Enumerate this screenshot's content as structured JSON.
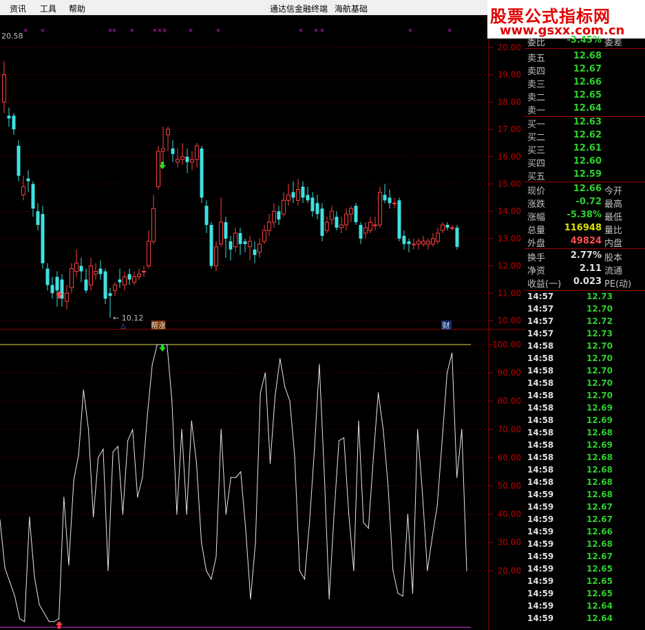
{
  "menu": {
    "items": [
      "资讯",
      "工具",
      "帮助"
    ],
    "title": "通达信金融终端",
    "module": "海航基础"
  },
  "watermark": {
    "line1": "股票公式指标网",
    "line2": "www.gsxx.com.cn",
    "diamond": "◇"
  },
  "price_panel": {
    "top_value": "20.58",
    "low_marker": "10.12",
    "badge_bangzhang": "帮涨",
    "badge_cai": "财",
    "badge_triangle": "△"
  },
  "chart_data": [
    {
      "type": "candlestick",
      "title": "",
      "y_ticks": [
        "20.00",
        "19.00",
        "18.00",
        "17.00",
        "16.00",
        "15.00",
        "14.00",
        "13.00",
        "12.00",
        "11.00",
        "10.00"
      ],
      "ylim": [
        9.6,
        21.2
      ],
      "candles": [
        {
          "o": 18.0,
          "c": 19.0,
          "h": 19.5,
          "l": 17.6
        },
        {
          "o": 17.5,
          "c": 17.4,
          "h": 17.8,
          "l": 17.1
        },
        {
          "o": 17.5,
          "c": 17.0,
          "h": 17.6,
          "l": 16.8
        },
        {
          "o": 16.4,
          "c": 15.3,
          "h": 16.6,
          "l": 15.1
        },
        {
          "o": 14.6,
          "c": 14.9,
          "h": 15.3,
          "l": 14.4
        },
        {
          "o": 15.2,
          "c": 15.1,
          "h": 15.5,
          "l": 14.7
        },
        {
          "o": 15.0,
          "c": 14.1,
          "h": 15.1,
          "l": 13.8
        },
        {
          "o": 14.0,
          "c": 13.5,
          "h": 14.3,
          "l": 13.3
        },
        {
          "o": 13.9,
          "c": 12.1,
          "h": 14.2,
          "l": 11.9
        },
        {
          "o": 11.9,
          "c": 11.3,
          "h": 12.1,
          "l": 11.1
        },
        {
          "o": 11.3,
          "c": 11.0,
          "h": 11.6,
          "l": 10.8
        },
        {
          "o": 11.6,
          "c": 11.1,
          "h": 11.8,
          "l": 10.5
        },
        {
          "o": 11.5,
          "c": 10.8,
          "h": 11.7,
          "l": 10.5
        },
        {
          "o": 10.7,
          "c": 11.0,
          "h": 11.3,
          "l": 10.4
        },
        {
          "o": 11.2,
          "c": 11.9,
          "h": 12.1,
          "l": 11.0
        },
        {
          "o": 11.8,
          "c": 12.1,
          "h": 12.6,
          "l": 11.6
        },
        {
          "o": 12.0,
          "c": 11.8,
          "h": 12.3,
          "l": 11.4
        },
        {
          "o": 11.5,
          "c": 11.1,
          "h": 11.9,
          "l": 11.0
        },
        {
          "o": 11.3,
          "c": 12.0,
          "h": 12.3,
          "l": 11.1
        },
        {
          "o": 11.7,
          "c": 11.8,
          "h": 12.1,
          "l": 11.5
        },
        {
          "o": 11.9,
          "c": 11.7,
          "h": 12.2,
          "l": 11.5
        },
        {
          "o": 11.8,
          "c": 10.8,
          "h": 11.9,
          "l": 10.6
        },
        {
          "o": 11.0,
          "c": 10.9,
          "h": 11.2,
          "l": 10.1
        },
        {
          "o": 11.1,
          "c": 11.3,
          "h": 11.4,
          "l": 10.9
        },
        {
          "o": 11.5,
          "c": 11.4,
          "h": 11.9,
          "l": 11.2
        },
        {
          "o": 11.3,
          "c": 11.6,
          "h": 11.8,
          "l": 11.1
        },
        {
          "o": 11.7,
          "c": 11.5,
          "h": 11.9,
          "l": 11.3
        },
        {
          "o": 11.4,
          "c": 11.6,
          "h": 11.8,
          "l": 11.3
        },
        {
          "o": 11.6,
          "c": 11.7,
          "h": 11.9,
          "l": 11.5
        },
        {
          "o": 11.8,
          "c": 11.8,
          "h": 12.0,
          "l": 11.6
        },
        {
          "o": 12.0,
          "c": 12.9,
          "h": 13.3,
          "l": 11.9
        },
        {
          "o": 12.9,
          "c": 14.1,
          "h": 14.6,
          "l": 12.8
        },
        {
          "o": 14.9,
          "c": 16.2,
          "h": 16.4,
          "l": 14.8
        },
        {
          "o": 16.2,
          "c": 16.3,
          "h": 17.1,
          "l": 15.8
        },
        {
          "o": 16.8,
          "c": 17.0,
          "h": 17.1,
          "l": 16.2
        },
        {
          "o": 16.3,
          "c": 16.1,
          "h": 16.6,
          "l": 15.8
        },
        {
          "o": 15.8,
          "c": 15.9,
          "h": 16.3,
          "l": 15.6
        },
        {
          "o": 15.9,
          "c": 16.0,
          "h": 16.5,
          "l": 15.7
        },
        {
          "o": 16.0,
          "c": 15.8,
          "h": 16.3,
          "l": 15.4
        },
        {
          "o": 15.8,
          "c": 15.9,
          "h": 16.2,
          "l": 15.5
        },
        {
          "o": 15.9,
          "c": 16.4,
          "h": 16.5,
          "l": 15.6
        },
        {
          "o": 16.3,
          "c": 14.5,
          "h": 16.4,
          "l": 14.3
        },
        {
          "o": 14.2,
          "c": 13.5,
          "h": 14.4,
          "l": 13.2
        },
        {
          "o": 13.5,
          "c": 12.0,
          "h": 13.6,
          "l": 11.9
        },
        {
          "o": 12.0,
          "c": 12.7,
          "h": 12.9,
          "l": 11.8
        },
        {
          "o": 12.8,
          "c": 13.6,
          "h": 14.5,
          "l": 12.7
        },
        {
          "o": 13.6,
          "c": 13.0,
          "h": 13.8,
          "l": 12.3
        },
        {
          "o": 12.9,
          "c": 12.6,
          "h": 13.1,
          "l": 12.2
        },
        {
          "o": 12.7,
          "c": 13.2,
          "h": 13.4,
          "l": 12.5
        },
        {
          "o": 13.2,
          "c": 12.8,
          "h": 13.4,
          "l": 12.4
        },
        {
          "o": 12.9,
          "c": 12.8,
          "h": 13.0,
          "l": 12.5
        },
        {
          "o": 12.7,
          "c": 12.9,
          "h": 13.1,
          "l": 12.2
        },
        {
          "o": 12.6,
          "c": 12.4,
          "h": 12.9,
          "l": 12.1
        },
        {
          "o": 12.5,
          "c": 12.8,
          "h": 13.0,
          "l": 12.3
        },
        {
          "o": 12.9,
          "c": 13.3,
          "h": 13.5,
          "l": 12.8
        },
        {
          "o": 13.3,
          "c": 13.6,
          "h": 13.9,
          "l": 13.1
        },
        {
          "o": 13.6,
          "c": 14.0,
          "h": 14.3,
          "l": 13.4
        },
        {
          "o": 14.0,
          "c": 13.7,
          "h": 14.2,
          "l": 13.5
        },
        {
          "o": 13.9,
          "c": 14.4,
          "h": 14.7,
          "l": 13.8
        },
        {
          "o": 14.4,
          "c": 14.6,
          "h": 15.0,
          "l": 14.2
        },
        {
          "o": 14.7,
          "c": 14.5,
          "h": 15.1,
          "l": 14.3
        },
        {
          "o": 14.4,
          "c": 14.8,
          "h": 15.2,
          "l": 14.2
        },
        {
          "o": 14.9,
          "c": 14.5,
          "h": 15.1,
          "l": 14.3
        },
        {
          "o": 14.6,
          "c": 14.4,
          "h": 14.9,
          "l": 14.3
        },
        {
          "o": 14.5,
          "c": 14.0,
          "h": 14.7,
          "l": 13.8
        },
        {
          "o": 14.3,
          "c": 13.9,
          "h": 14.6,
          "l": 13.7
        },
        {
          "o": 14.1,
          "c": 13.1,
          "h": 14.3,
          "l": 12.9
        },
        {
          "o": 13.3,
          "c": 13.6,
          "h": 13.8,
          "l": 13.2
        },
        {
          "o": 13.7,
          "c": 14.0,
          "h": 14.2,
          "l": 13.5
        },
        {
          "o": 13.8,
          "c": 13.4,
          "h": 14.0,
          "l": 13.3
        },
        {
          "o": 13.4,
          "c": 13.5,
          "h": 13.8,
          "l": 13.2
        },
        {
          "o": 13.5,
          "c": 13.9,
          "h": 14.1,
          "l": 13.3
        },
        {
          "o": 13.9,
          "c": 14.1,
          "h": 14.2,
          "l": 13.6
        },
        {
          "o": 14.2,
          "c": 13.6,
          "h": 14.3,
          "l": 13.5
        },
        {
          "o": 13.5,
          "c": 13.0,
          "h": 13.6,
          "l": 12.8
        },
        {
          "o": 13.2,
          "c": 13.4,
          "h": 13.6,
          "l": 13.0
        },
        {
          "o": 13.3,
          "c": 13.6,
          "h": 13.8,
          "l": 13.2
        },
        {
          "o": 13.5,
          "c": 13.5,
          "h": 13.8,
          "l": 13.3
        },
        {
          "o": 13.5,
          "c": 14.7,
          "h": 14.9,
          "l": 13.4
        },
        {
          "o": 14.6,
          "c": 14.4,
          "h": 15.0,
          "l": 14.3
        },
        {
          "o": 14.5,
          "c": 14.3,
          "h": 14.8,
          "l": 14.1
        },
        {
          "o": 14.3,
          "c": 14.3,
          "h": 14.5,
          "l": 14.1
        },
        {
          "o": 14.4,
          "c": 13.0,
          "h": 14.5,
          "l": 12.9
        },
        {
          "o": 13.1,
          "c": 12.8,
          "h": 13.3,
          "l": 12.6
        },
        {
          "o": 12.9,
          "c": 12.8,
          "h": 13.0,
          "l": 12.5
        },
        {
          "o": 12.8,
          "c": 12.8,
          "h": 13.0,
          "l": 12.6
        },
        {
          "o": 12.8,
          "c": 12.9,
          "h": 13.0,
          "l": 12.6
        },
        {
          "o": 12.8,
          "c": 12.9,
          "h": 13.1,
          "l": 12.7
        },
        {
          "o": 12.8,
          "c": 12.9,
          "h": 13.0,
          "l": 12.6
        },
        {
          "o": 12.8,
          "c": 13.0,
          "h": 13.2,
          "l": 12.7
        },
        {
          "o": 12.9,
          "c": 13.2,
          "h": 13.4,
          "l": 12.8
        },
        {
          "o": 13.3,
          "c": 13.5,
          "h": 13.6,
          "l": 13.2
        },
        {
          "o": 13.5,
          "c": 13.4,
          "h": 13.6,
          "l": 13.3
        },
        {
          "o": 13.4,
          "c": 13.4,
          "h": 13.5,
          "l": 13.3
        },
        {
          "o": 13.4,
          "c": 12.7,
          "h": 13.5,
          "l": 12.6
        }
      ]
    },
    {
      "type": "line",
      "title": "",
      "y_ticks": [
        "100.00",
        "90.00",
        "80.00",
        "70.00",
        "60.00",
        "50.00",
        "40.00",
        "30.00",
        "20.00"
      ],
      "ylim": [
        0,
        100
      ],
      "series": [
        {
          "values": [
            38,
            21,
            16,
            11,
            3,
            2,
            39,
            18,
            8,
            5,
            2,
            2,
            3,
            46,
            22,
            52,
            61,
            84,
            70,
            39,
            60,
            63,
            20,
            62,
            64,
            40,
            66,
            70,
            46,
            53,
            75,
            93,
            100,
            100,
            100,
            80,
            40,
            70,
            40,
            73,
            58,
            30,
            20,
            17,
            25,
            70,
            40,
            53,
            53,
            55,
            35,
            10,
            30,
            83,
            90,
            58,
            82,
            95,
            85,
            80,
            60,
            20,
            17,
            37,
            63,
            93,
            55,
            10,
            40,
            66,
            67,
            40,
            20,
            73,
            37,
            35,
            60,
            83,
            70,
            50,
            20,
            12,
            11,
            40,
            12,
            70,
            47,
            20,
            32,
            43,
            66,
            90,
            97,
            53,
            70,
            20
          ]
        }
      ]
    }
  ],
  "quote": {
    "weibi": {
      "label": "委比",
      "value": "-3.45%",
      "ext": "委差"
    },
    "asks": [
      {
        "label": "卖五",
        "price": "12.68"
      },
      {
        "label": "卖四",
        "price": "12.67"
      },
      {
        "label": "卖三",
        "price": "12.66"
      },
      {
        "label": "卖二",
        "price": "12.65"
      },
      {
        "label": "卖一",
        "price": "12.64"
      }
    ],
    "bids": [
      {
        "label": "买一",
        "price": "12.63"
      },
      {
        "label": "买二",
        "price": "12.62"
      },
      {
        "label": "买三",
        "price": "12.61"
      },
      {
        "label": "买四",
        "price": "12.60"
      },
      {
        "label": "买五",
        "price": "12.59"
      }
    ],
    "stats": [
      {
        "label": "现价",
        "value": "12.66",
        "color": "#30d030",
        "ext": "今开"
      },
      {
        "label": "涨跌",
        "value": "-0.72",
        "color": "#30d030",
        "ext": "最高"
      },
      {
        "label": "涨幅",
        "value": "-5.38%",
        "color": "#30d030",
        "ext": "最低"
      },
      {
        "label": "总量",
        "value": "116948",
        "color": "#e0e000",
        "ext": "量比"
      },
      {
        "label": "外盘",
        "value": "49824",
        "color": "#ff5050",
        "ext": "内盘"
      }
    ],
    "stats2": [
      {
        "label": "换手",
        "value": "2.77%",
        "ext": "股本"
      },
      {
        "label": "净资",
        "value": "2.11",
        "ext": "流通"
      },
      {
        "label": "收益(一)",
        "value": "0.023",
        "ext": "PE(动)"
      }
    ],
    "ticks": [
      {
        "time": "14:57",
        "price": "12.73"
      },
      {
        "time": "14:57",
        "price": "12.70"
      },
      {
        "time": "14:57",
        "price": "12.72"
      },
      {
        "time": "14:57",
        "price": "12.73"
      },
      {
        "time": "14:58",
        "price": "12.70"
      },
      {
        "time": "14:58",
        "price": "12.70"
      },
      {
        "time": "14:58",
        "price": "12.70"
      },
      {
        "time": "14:58",
        "price": "12.70"
      },
      {
        "time": "14:58",
        "price": "12.70"
      },
      {
        "time": "14:58",
        "price": "12.69"
      },
      {
        "time": "14:58",
        "price": "12.69"
      },
      {
        "time": "14:58",
        "price": "12.68"
      },
      {
        "time": "14:58",
        "price": "12.69"
      },
      {
        "time": "14:58",
        "price": "12.68"
      },
      {
        "time": "14:58",
        "price": "12.68"
      },
      {
        "time": "14:58",
        "price": "12.68"
      },
      {
        "time": "14:59",
        "price": "12.68"
      },
      {
        "time": "14:59",
        "price": "12.67"
      },
      {
        "time": "14:59",
        "price": "12.67"
      },
      {
        "time": "14:59",
        "price": "12.66"
      },
      {
        "time": "14:59",
        "price": "12.68"
      },
      {
        "time": "14:59",
        "price": "12.67"
      },
      {
        "time": "14:59",
        "price": "12.65"
      },
      {
        "time": "14:59",
        "price": "12.65"
      },
      {
        "time": "14:59",
        "price": "12.65"
      },
      {
        "time": "14:59",
        "price": "12.64"
      },
      {
        "time": "14:59",
        "price": "12.64"
      }
    ]
  }
}
